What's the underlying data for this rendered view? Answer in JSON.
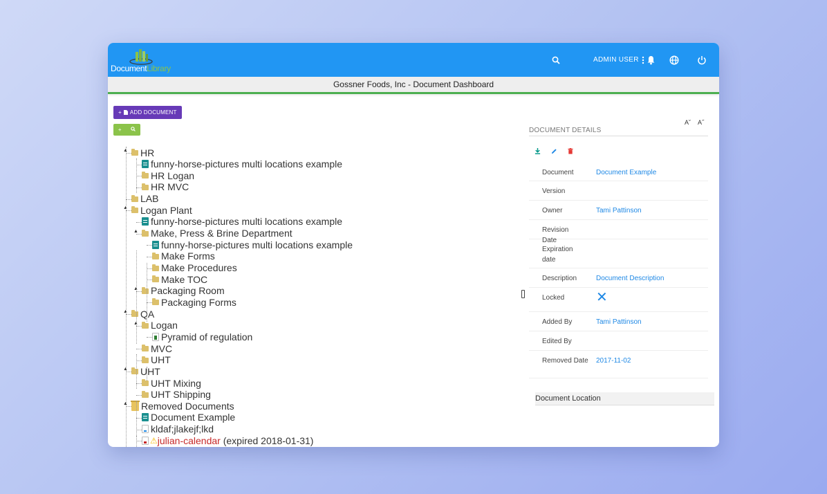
{
  "app": {
    "logo_word1": "Document",
    "logo_word2": "Library",
    "user_label": "ADMIN USER",
    "company_title": "Gossner Foods, Inc - Document Dashboard",
    "icons": [
      "search-icon",
      "more-vert-icon",
      "bell-icon",
      "globe-icon",
      "power-icon"
    ]
  },
  "toolbar": {
    "add_document_label": "ADD DOCUMENT",
    "expand_symbol": "+",
    "search_symbol": "⌕"
  },
  "tree": {
    "nodes": [
      {
        "label": "HR",
        "icon": "folder"
      },
      {
        "label": "funny-horse-pictures multi locations example",
        "icon": "file"
      },
      {
        "label": "HR Logan",
        "icon": "folder"
      },
      {
        "label": "HR MVC",
        "icon": "folder"
      },
      {
        "label": "LAB",
        "icon": "folder"
      },
      {
        "label": "Logan Plant",
        "icon": "folder"
      },
      {
        "label": "funny-horse-pictures multi locations example",
        "icon": "file"
      },
      {
        "label": "Make, Press & Brine Department",
        "icon": "folder"
      },
      {
        "label": "funny-horse-pictures multi locations example",
        "icon": "file"
      },
      {
        "label": "Make Forms",
        "icon": "folder"
      },
      {
        "label": "Make Procedures",
        "icon": "folder"
      },
      {
        "label": "Make TOC",
        "icon": "folder"
      },
      {
        "label": "Packaging Room",
        "icon": "folder"
      },
      {
        "label": "Packaging Forms",
        "icon": "folder"
      },
      {
        "label": "QA",
        "icon": "folder"
      },
      {
        "label": "Logan",
        "icon": "folder"
      },
      {
        "label": "Pyramid of regulation",
        "icon": "xls"
      },
      {
        "label": "MVC",
        "icon": "folder"
      },
      {
        "label": "UHT",
        "icon": "folder"
      },
      {
        "label": "UHT",
        "icon": "folder"
      },
      {
        "label": "UHT Mixing",
        "icon": "folder"
      },
      {
        "label": "UHT Shipping",
        "icon": "folder"
      },
      {
        "label": "Removed Documents",
        "icon": "trash"
      },
      {
        "label": "Document Example",
        "icon": "file"
      },
      {
        "label": "kldaf;jlakejf;lkd",
        "icon": "txt"
      },
      {
        "label": "julian-calendar",
        "icon": "pdf",
        "warning": "⚠",
        "suffix": " (expired 2018-01-31)"
      }
    ]
  },
  "details": {
    "title": "DOCUMENT DETAILS",
    "font_decrease": "A˘",
    "font_increase": "A˝",
    "rows": [
      {
        "key": "Document",
        "value": "Document Example"
      },
      {
        "key": "Version",
        "value": ""
      },
      {
        "key": "Owner",
        "value": "Tami Pattinson"
      },
      {
        "key": "Revision Date",
        "value": ""
      },
      {
        "key": "Expiration date",
        "value": ""
      },
      {
        "key": "Description",
        "value": "Document Description"
      },
      {
        "key": "Locked",
        "value": "✕"
      },
      {
        "key": "Added By",
        "value": "Tami Pattinson"
      },
      {
        "key": "Edited By",
        "value": ""
      },
      {
        "key": "Removed Date",
        "value": "2017-11-02"
      }
    ],
    "location_label": "Document Location",
    "colors": {
      "accent": "#2196f3",
      "link": "#1e88e5",
      "delete": "#e53935",
      "download": "#009688",
      "add_button": "#673ab7",
      "green": "#8bc34a"
    }
  }
}
